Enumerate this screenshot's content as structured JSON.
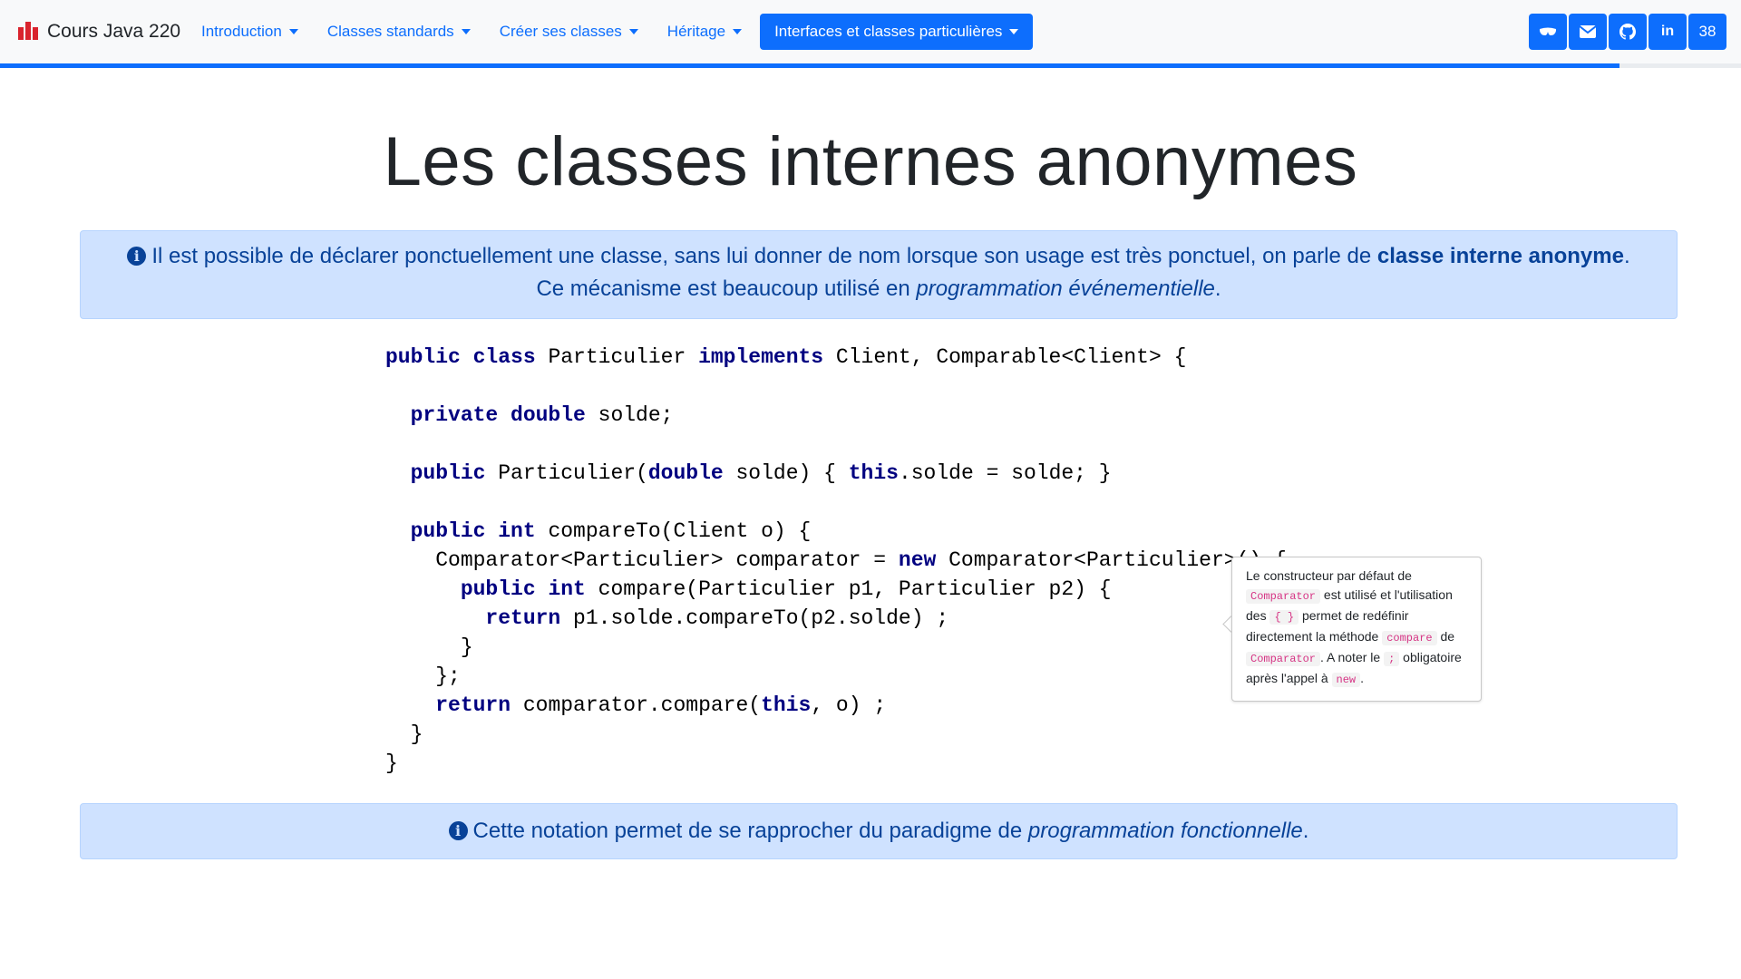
{
  "navbar": {
    "brand_title": "Cours Java 220",
    "menu": [
      {
        "label": "Introduction"
      },
      {
        "label": "Classes standards"
      },
      {
        "label": "Créer ses classes"
      },
      {
        "label": "Héritage"
      },
      {
        "label": "Interfaces et classes particulières",
        "active": true
      }
    ],
    "actions": [
      {
        "icon": "glasses-icon"
      },
      {
        "icon": "envelope-icon"
      },
      {
        "icon": "github-icon"
      },
      {
        "icon": "linkedin-icon",
        "text": "in"
      },
      {
        "text": "38"
      }
    ],
    "progress": 0.93,
    "accent": "#0d6efd"
  },
  "page": {
    "title": "Les classes internes anonymes",
    "info1": {
      "before": "Il est possible de déclarer ponctuellement une classe, sans lui donner de nom lorsque son usage est très ponctuel, on parle de ",
      "bold": "classe interne anonyme",
      "middle": ". Ce mécanisme est beaucoup utilisé en ",
      "italic": "programmation événementielle",
      "after": "."
    },
    "code": [
      [
        {
          "t": "public class",
          "k": true
        },
        {
          "t": " Particulier "
        },
        {
          "t": "implements",
          "k": true
        },
        {
          "t": " Client, Comparable<Client> {"
        }
      ],
      [],
      [
        {
          "t": "  "
        },
        {
          "t": "private double",
          "k": true
        },
        {
          "t": " solde;"
        }
      ],
      [],
      [
        {
          "t": "  "
        },
        {
          "t": "public",
          "k": true
        },
        {
          "t": " Particulier("
        },
        {
          "t": "double",
          "k": true
        },
        {
          "t": " solde) { "
        },
        {
          "t": "this",
          "k": true
        },
        {
          "t": ".solde = solde; }"
        }
      ],
      [],
      [
        {
          "t": "  "
        },
        {
          "t": "public int",
          "k": true
        },
        {
          "t": " compareTo(Client o) {"
        }
      ],
      [
        {
          "t": "    Comparator<Particulier> comparator = "
        },
        {
          "t": "new",
          "k": true
        },
        {
          "t": " Comparator<Particulier>() {"
        }
      ],
      [
        {
          "t": "      "
        },
        {
          "t": "public int",
          "k": true
        },
        {
          "t": " compare(Particulier p1, Particulier p2) {"
        }
      ],
      [
        {
          "t": "        "
        },
        {
          "t": "return",
          "k": true
        },
        {
          "t": " p1.solde.compareTo(p2.solde) ;"
        }
      ],
      [
        {
          "t": "      }"
        }
      ],
      [
        {
          "t": "    };"
        }
      ],
      [
        {
          "t": "    "
        },
        {
          "t": "return",
          "k": true
        },
        {
          "t": " comparator.compare("
        },
        {
          "t": "this",
          "k": true
        },
        {
          "t": ", o) ;"
        }
      ],
      [
        {
          "t": "  }"
        }
      ],
      [
        {
          "t": "}"
        }
      ]
    ],
    "tooltip": {
      "p1": "Le constructeur par défaut de ",
      "c1": "Comparator",
      "p2": " est utilisé et l'utilisation des ",
      "c2": "{ }",
      "p3": " permet de redéfinir directement la méthode ",
      "c3": "compare",
      "p4": " de ",
      "c4": "Comparator",
      "p5": ". A noter le ",
      "c5": ";",
      "p6": " obligatoire après l'appel à ",
      "c6": "new",
      "p7": "."
    },
    "info2": {
      "before": "Cette notation permet de se rapprocher du paradigme de ",
      "italic": "programmation fonctionnelle",
      "after": "."
    }
  }
}
